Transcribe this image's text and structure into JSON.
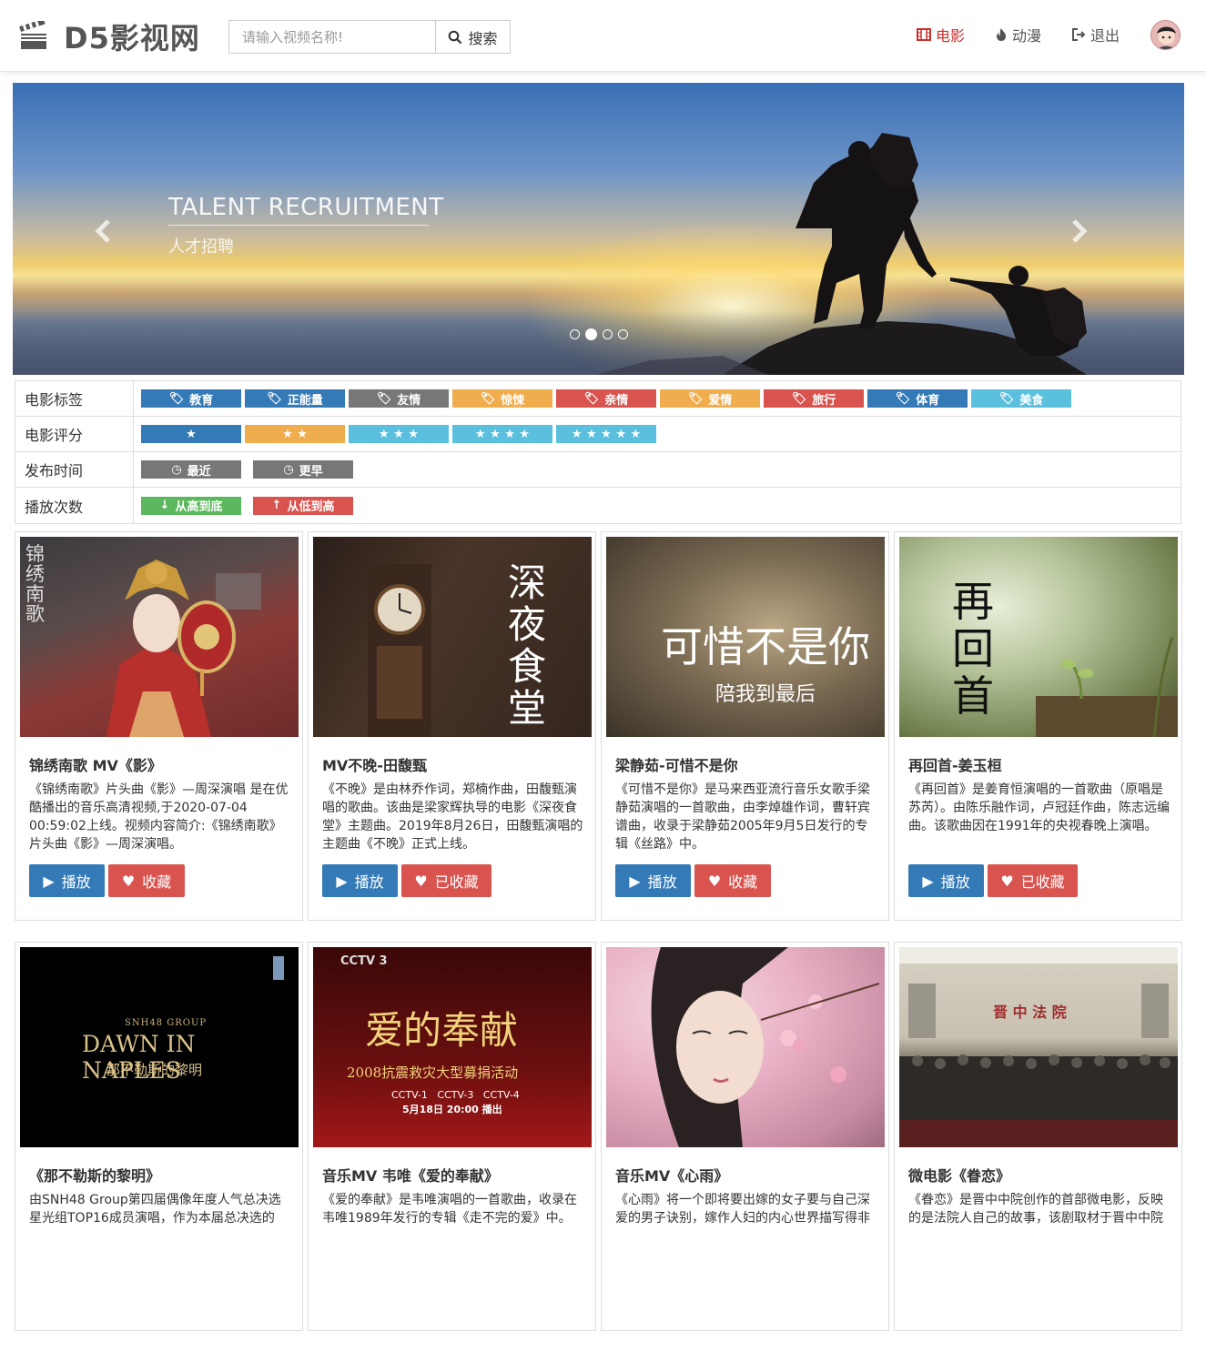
{
  "brand": {
    "name": "D5影视网",
    "logo": "clapperboard-icon"
  },
  "search": {
    "placeholder": "请输入视频名称!",
    "button_label": "搜索"
  },
  "nav": [
    {
      "label": "电影",
      "icon": "film-icon",
      "active": true
    },
    {
      "label": "动漫",
      "icon": "fire-icon",
      "active": false
    },
    {
      "label": "退出",
      "icon": "logout-icon",
      "active": false
    }
  ],
  "carousel": {
    "title": "TALENT RECRUITMENT",
    "subtitle": "人才招聘",
    "slide_count": 4,
    "active_slide": 2
  },
  "filters": {
    "tags": {
      "label": "电影标签",
      "items": [
        {
          "text": "教育",
          "color": "#337ab7"
        },
        {
          "text": "正能量",
          "color": "#337ab7"
        },
        {
          "text": "友情",
          "color": "#777777"
        },
        {
          "text": "惊悚",
          "color": "#f0ad4e"
        },
        {
          "text": "亲情",
          "color": "#d9534f"
        },
        {
          "text": "爱情",
          "color": "#f0ad4e"
        },
        {
          "text": "旅行",
          "color": "#d9534f"
        },
        {
          "text": "体育",
          "color": "#337ab7"
        },
        {
          "text": "美食",
          "color": "#5bc0de"
        }
      ]
    },
    "rating": {
      "label": "电影评分",
      "items": [
        "★",
        "★ ★",
        "★ ★ ★",
        "★ ★ ★ ★",
        "★ ★ ★ ★ ★"
      ]
    },
    "time": {
      "label": "发布时间",
      "items": [
        "最近",
        "更早"
      ]
    },
    "plays": {
      "label": "播放次数",
      "items": [
        "从高到底",
        "从低到高"
      ]
    }
  },
  "buttons": {
    "play": "播放",
    "fav": "收藏",
    "faved": "已收藏"
  },
  "videos": [
    {
      "title": "锦绣南歌 MV《影》",
      "desc": "《锦绣南歌》片头曲《影》—周深演唱 是在优酷播出的音乐高清视频,于2020-07-04 00:59:02上线。视频内容简介:《锦绣南歌》片头曲《影》—周深演唱。",
      "faved": false,
      "thumb_text": "锦绣南歌"
    },
    {
      "title": "MV不晚-田馥甄",
      "desc": "《不晚》是由林乔作词，郑楠作曲，田馥甄演唱的歌曲。该曲是梁家辉执导的电影《深夜食堂》主题曲。2019年8月26日，田馥甄演唱的主题曲《不晚》正式上线。",
      "faved": true,
      "thumb_text": "深夜食堂"
    },
    {
      "title": "梁静茹-可惜不是你",
      "desc": "《可惜不是你》是马来西亚流行音乐女歌手梁静茹演唱的一首歌曲，由李焯雄作词，曹轩宾谱曲，收录于梁静茹2005年9月5日发行的专辑《丝路》中。",
      "faved": false,
      "thumb_text": "可惜不是你",
      "thumb_sub": "陪我到最后"
    },
    {
      "title": "再回首-姜玉桓",
      "desc": "《再回首》是姜育恒演唱的一首歌曲（原唱是苏芮）。由陈乐融作词，卢冠廷作曲，陈志远编曲。该歌曲因在1991年的央视春晚上演唱。",
      "faved": true,
      "thumb_text": "再回首"
    },
    {
      "title": "《那不勒斯的黎明》",
      "desc": "由SNH48 Group第四届偶像年度人气总决选星光组TOP16成员演唱，作为本届总决选的",
      "faved": false,
      "thumb_text": "DAWN IN NAPLES",
      "thumb_sub": "那不勒斯的黎明",
      "thumb_top": "SNH48 GROUP"
    },
    {
      "title": "音乐MV 韦唯《爱的奉献》",
      "desc": "《爱的奉献》是韦唯演唱的一首歌曲，收录在韦唯1989年发行的专辑《走不完的爱》中。",
      "faved": false,
      "thumb_text": "爱的奉献",
      "thumb_sub": "2008抗震救灾大型募捐活动",
      "thumb_line": "CCTV-1   CCTV-3   CCTV-4",
      "thumb_date": "5月18日 20:00 播出",
      "thumb_logo": "CCTV 3"
    },
    {
      "title": "音乐MV《心雨》",
      "desc": "《心雨》将一个即将要出嫁的女子要与自己深爱的男子诀别，嫁作人妇的内心世界描写得非",
      "faved": false,
      "thumb_text": ""
    },
    {
      "title": "微电影《眷恋》",
      "desc": "《眷恋》是晋中中院创作的首部微电影，反映的是法院人自己的故事，该剧取材于晋中中院",
      "faved": false,
      "thumb_text": "晋 中 法 院"
    }
  ]
}
